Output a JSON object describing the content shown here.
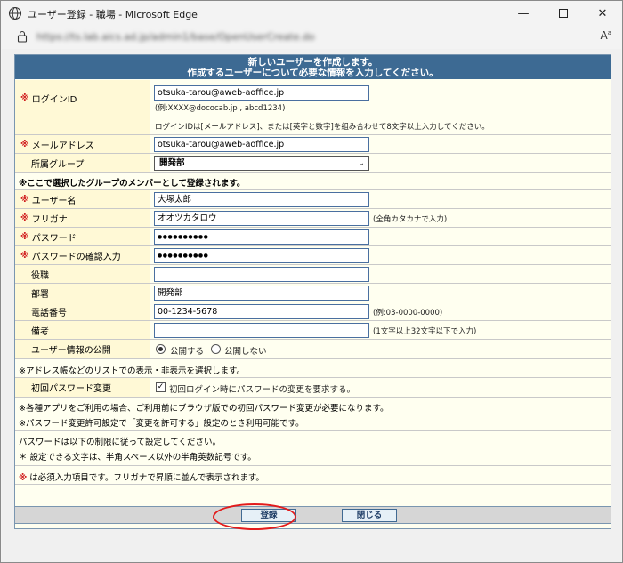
{
  "window": {
    "title": "ユーザー登録 - 職場 - Microsoft Edge",
    "url": "https://ts.lab.aics.ad.jp/admin1/base/OpenUserCreate.do"
  },
  "header": {
    "line1": "新しいユーザーを作成します。",
    "line2": "作成するユーザーについて必要な情報を入力してください。"
  },
  "form": {
    "required_mark": "※",
    "login_id": {
      "label": "ログインID",
      "value": "otsuka-tarou@aweb-aoffice.jp",
      "example": "(例:XXXX@dococab.jp , abcd1234)"
    },
    "login_note": "ログインIDは[メールアドレス]、または[英字と数字]を組み合わせて8文字以上入力してください。",
    "email": {
      "label": "メールアドレス",
      "value": "otsuka-tarou@aweb-aoffice.jp"
    },
    "group": {
      "label": "所属グループ",
      "value": "開発部"
    },
    "group_note": "※ここで選択したグループのメンバーとして登録されます。",
    "user_name": {
      "label": "ユーザー名",
      "value": "大塚太郎"
    },
    "furigana": {
      "label": "フリガナ",
      "value": "オオツカタロウ",
      "hint": "(全角カタカナで入力)"
    },
    "password": {
      "label": "パスワード",
      "value": "●●●●●●●●●●"
    },
    "password_confirm": {
      "label": "パスワードの確認入力",
      "value": "●●●●●●●●●●"
    },
    "position": {
      "label": "役職",
      "value": ""
    },
    "department": {
      "label": "部署",
      "value": "開発部"
    },
    "phone": {
      "label": "電話番号",
      "value": "00-1234-5678",
      "hint": "(例:03-0000-0000)"
    },
    "remarks": {
      "label": "備考",
      "value": "",
      "hint": "(1文字以上32文字以下で入力)"
    },
    "publish": {
      "label": "ユーザー情報の公開",
      "opt_public": "公開する",
      "opt_private": "公開しない",
      "selected": "public"
    },
    "publish_note": "※アドレス帳などのリストでの表示・非表示を選択します。",
    "initial_pw": {
      "label": "初回パスワード変更",
      "check_label": "初回ログイン時にパスワードの変更を要求する。",
      "checked": true
    },
    "app_note1": "※各種アプリをご利用の場合、ご利用前にブラウザ版での初回パスワード変更が必要になります。",
    "app_note2": "※パスワード変更許可設定で「変更を許可する」設定のとき利用可能です。",
    "pw_rule1": "パスワードは以下の制限に従って設定してください。",
    "pw_rule2": "＊ 設定できる文字は、半角スペース以外の半角英数記号です。",
    "required_note": "は必須入力項目です。フリガナで昇順に並んで表示されます。"
  },
  "buttons": {
    "register": "登録",
    "close": "閉じる"
  }
}
